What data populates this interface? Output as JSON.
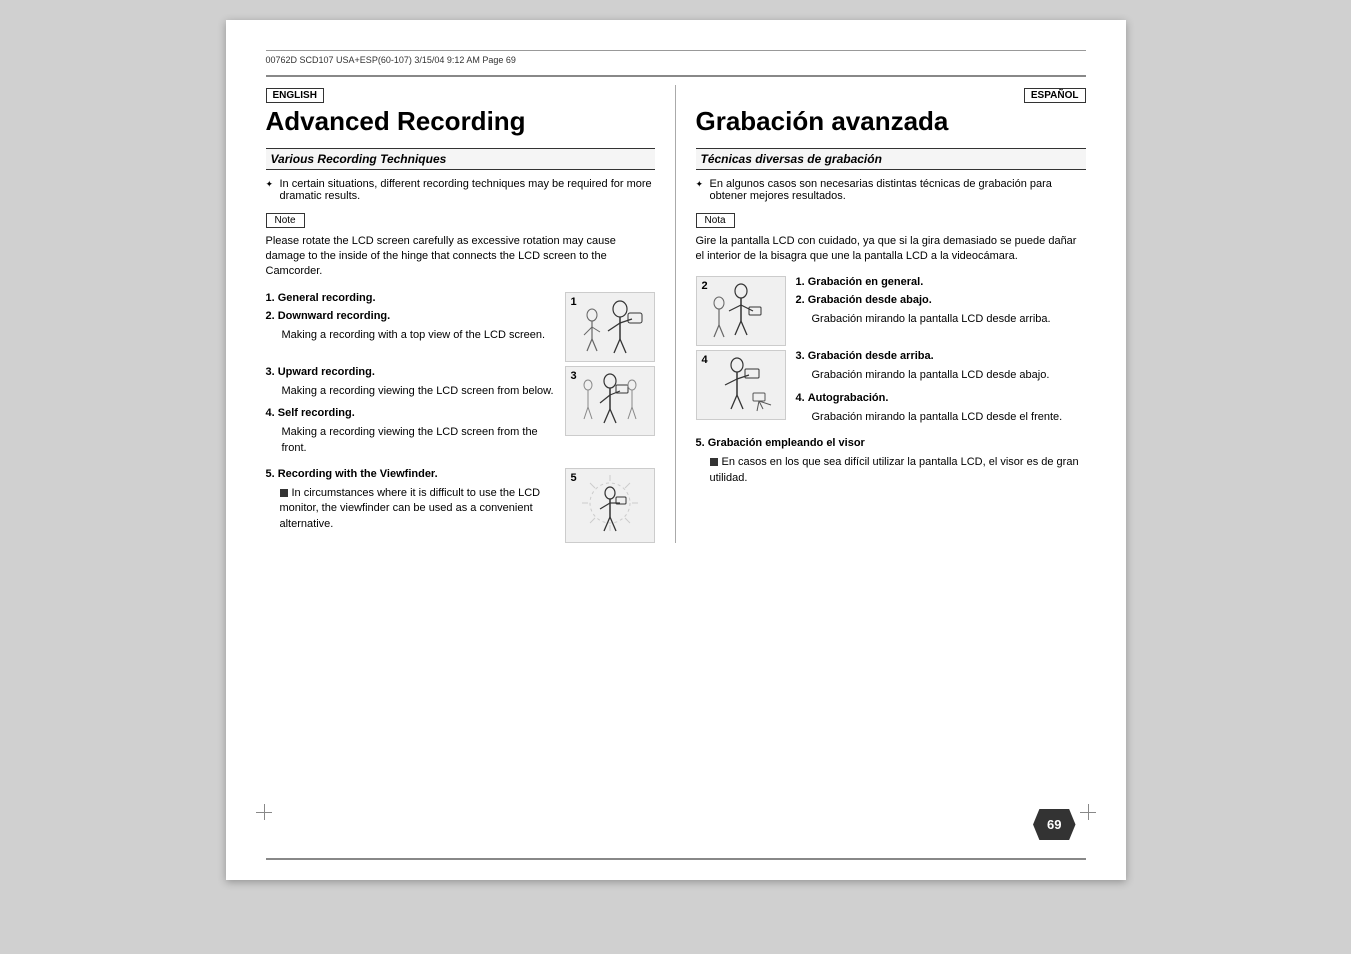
{
  "meta": {
    "line": "00762D  SCD107  USA+ESP(60-107)    3/15/04  9:12 AM    Page  69"
  },
  "english": {
    "badge": "ENGLISH",
    "title": "Advanced Recording",
    "section_heading": "Various Recording Techniques",
    "intro_bullet": "In certain situations, different recording techniques may be required for more dramatic results.",
    "note_label": "Note",
    "note_text": "Please rotate the LCD screen carefully as excessive rotation may cause damage to the inside of the hinge that connects the LCD screen to the Camcorder.",
    "items": [
      {
        "num": "1.",
        "label": "General recording."
      },
      {
        "num": "2.",
        "label": "Downward recording.",
        "sub": "Making a recording with a top view of the LCD screen."
      },
      {
        "num": "3.",
        "label": "Upward recording.",
        "sub": "Making a recording viewing the LCD screen from below."
      },
      {
        "num": "4.",
        "label": "Self recording.",
        "sub": "Making a recording viewing the LCD screen from the front."
      },
      {
        "num": "5.",
        "label": "Recording with the Viewfinder.",
        "sub_square": "In circumstances where it is difficult to use the LCD monitor, the viewfinder can be used as a convenient alternative."
      }
    ]
  },
  "espanol": {
    "badge": "ESPAÑOL",
    "title": "Grabación avanzada",
    "section_heading": "Técnicas diversas de grabación",
    "intro_bullet": "En algunos casos son necesarias distintas técnicas de grabación para obtener mejores resultados.",
    "note_label": "Nota",
    "note_text": "Gire la pantalla LCD con cuidado, ya que si la gira demasiado se puede dañar el interior de la bisagra que une la pantalla LCD a la videocámara.",
    "items": [
      {
        "num": "1.",
        "label": "Grabación en general."
      },
      {
        "num": "2.",
        "label": "Grabación desde abajo.",
        "sub": "Grabación mirando la pantalla LCD desde arriba."
      },
      {
        "num": "3.",
        "label": "Grabación desde arriba.",
        "sub": "Grabación mirando la pantalla LCD desde abajo."
      },
      {
        "num": "4.",
        "label": "Autograbación.",
        "sub": "Grabación mirando la pantalla LCD desde el frente."
      },
      {
        "num": "5.",
        "label": "Grabación empleando el visor",
        "sub_square": "En casos en los que sea difícil utilizar la pantalla LCD, el visor es de gran utilidad."
      }
    ]
  },
  "page_number": "69",
  "illustrations": {
    "box1_label": "1",
    "box2_label": "2",
    "box3_label": "3",
    "box4_label": "4",
    "box5_label": "5"
  }
}
